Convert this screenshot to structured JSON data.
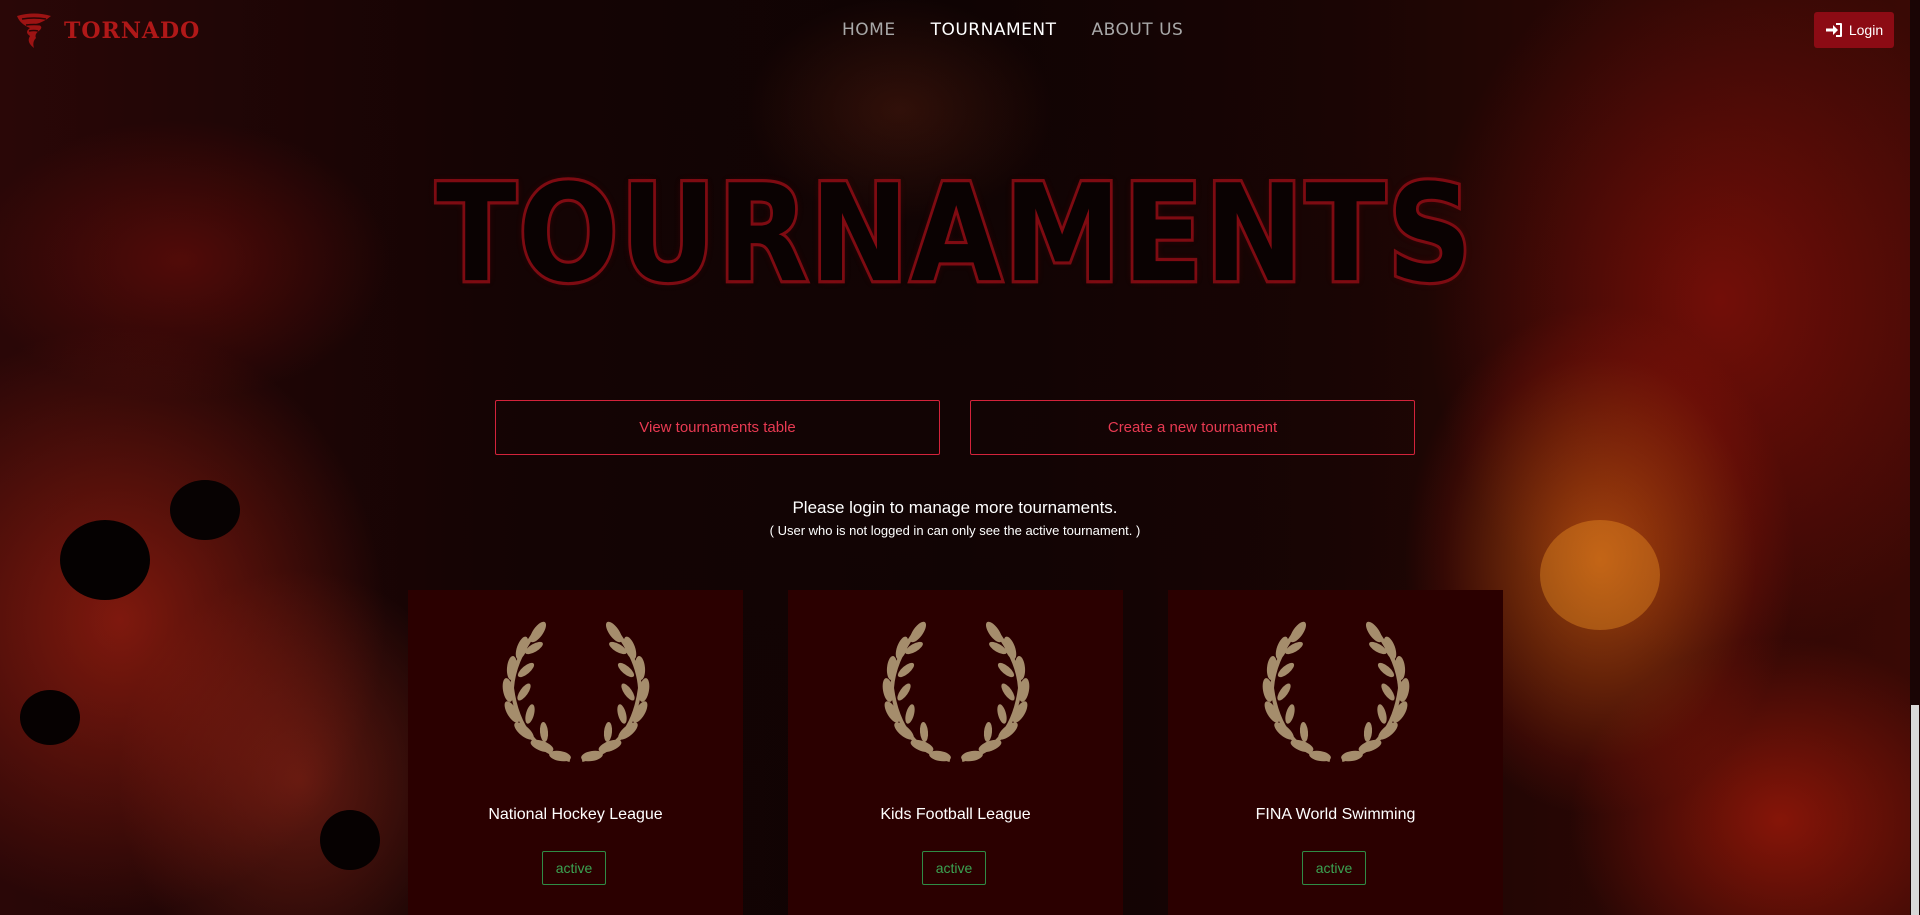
{
  "brand": {
    "name": "TORNADO",
    "icon": "tornado-icon"
  },
  "nav": {
    "links": [
      {
        "label": "HOME",
        "active": false
      },
      {
        "label": "TOURNAMENT",
        "active": true
      },
      {
        "label": "ABOUT US",
        "active": false
      }
    ],
    "login_label": "Login",
    "login_icon": "sign-in-icon"
  },
  "hero": {
    "title": "TOURNAMENTS"
  },
  "actions": {
    "view_table": "View tournaments table",
    "create_new": "Create a new tournament"
  },
  "notice": {
    "main": "Please login to manage more tournaments.",
    "sub": "( User who is not logged in can only see the active tournament. )"
  },
  "tournaments": [
    {
      "name": "National Hockey League",
      "status": "active",
      "icon": "laurel-wreath-icon"
    },
    {
      "name": "Kids Football League",
      "status": "active",
      "icon": "laurel-wreath-icon"
    },
    {
      "name": "FINA World Swimming",
      "status": "active",
      "icon": "laurel-wreath-icon"
    }
  ],
  "colors": {
    "accent": "#d3233b",
    "login_bg": "#8c0b14",
    "card_bg": "#2b0000",
    "status_green": "#3aa352",
    "laurel": "#a58d6c"
  }
}
